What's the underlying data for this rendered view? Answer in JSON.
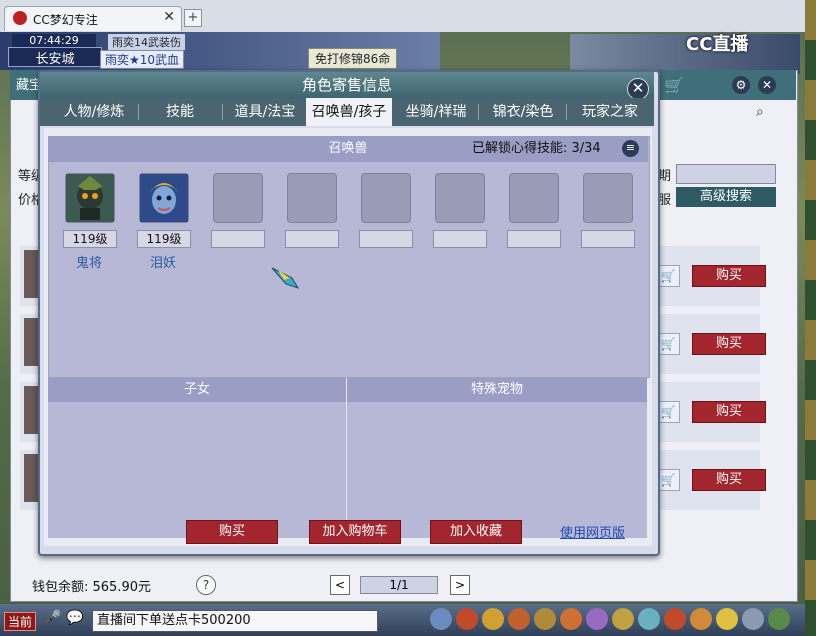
{
  "browser": {
    "tab_title": "CC梦幻专注",
    "close_glyph": "✕",
    "new_tab_glyph": "+"
  },
  "hud": {
    "time": "07:44:29",
    "city": "长安城",
    "news1": "雨奕14武装伤",
    "news2": "雨奕★10武血",
    "news3": "免打修锦86命",
    "stream_logo": "CC直播"
  },
  "background_window": {
    "title_fragment": "藏宝",
    "level_label": "等级",
    "price_label": "价格",
    "right_label_1": "期",
    "right_label_2": "服",
    "advanced_search": "高级搜索",
    "buy_label": "购买",
    "balance": "钱包余额: 565.90元",
    "help": "?",
    "prev": "<",
    "next": ">",
    "page": "1/1"
  },
  "dialog": {
    "title": "角色寄售信息",
    "close": "✕",
    "tabs": [
      {
        "label": "人物/修炼",
        "active": false
      },
      {
        "label": "技能",
        "active": false
      },
      {
        "label": "道具/法宝",
        "active": false
      },
      {
        "label": "召唤兽/孩子",
        "active": true
      },
      {
        "label": "坐骑/祥瑞",
        "active": false
      },
      {
        "label": "锦衣/染色",
        "active": false
      },
      {
        "label": "玩家之家",
        "active": false
      }
    ],
    "pets_header": "召唤兽",
    "unlocked_skills": "已解锁心得技能: 3/34",
    "pets": [
      {
        "level": "119级",
        "name": "鬼将",
        "icon": "ghost-general-icon"
      },
      {
        "level": "119级",
        "name": "泪妖",
        "icon": "tear-demon-icon"
      }
    ],
    "empty_slots": 6,
    "children_header": "子女",
    "special_pets_header": "特殊宠物",
    "buttons": {
      "buy": "购买",
      "add_cart": "加入购物车",
      "add_fav": "加入收藏",
      "web_version": "使用网页版"
    }
  },
  "taskbar": {
    "current_channel": "当前",
    "chat_text": "直播间下单送点卡500200"
  },
  "colors": {
    "dialog_header": "#3f6570",
    "buy_red": "#a3262e",
    "pet_name_blue": "#2a5c9e"
  }
}
